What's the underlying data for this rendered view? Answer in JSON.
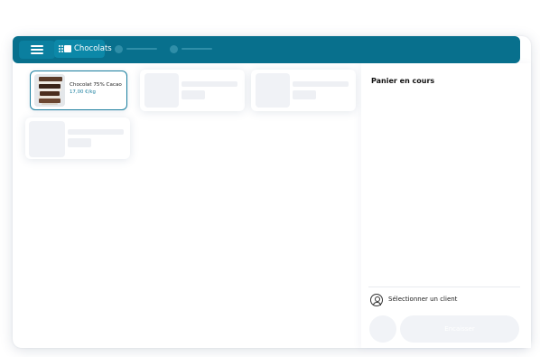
{
  "topbar": {
    "menu_icon": "hamburger-menu-icon",
    "category_label": "Chocolats",
    "category_icon": "grid-category-icon",
    "accent_color": "#08708d"
  },
  "products": [
    {
      "name": "Chocolat 75% Cacao",
      "price": "17,00 €/kg",
      "selected": true
    }
  ],
  "cart": {
    "title": "Panier en cours",
    "client_label": "Sélectionner un client",
    "client_icon": "user-circle-icon",
    "pay_label": "Encaisser"
  }
}
